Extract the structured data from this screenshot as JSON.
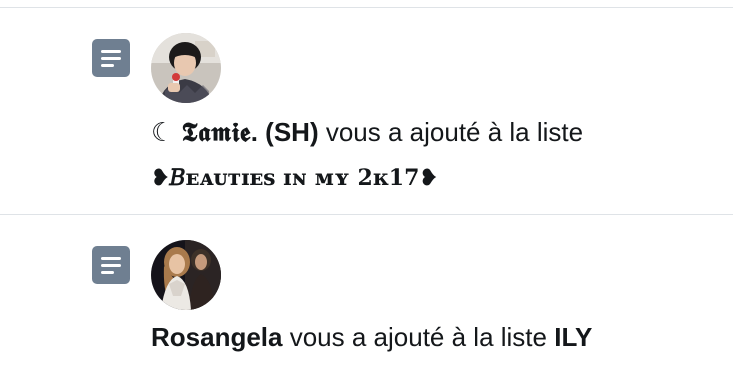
{
  "notifications": [
    {
      "icon": "list-icon",
      "avatar": "user-avatar",
      "moon": "☾",
      "user_name": "𝕿𝖆𝖒𝖎𝖊",
      "user_suffix": ". (SH)",
      "action_text": " vous a ajouté à la liste",
      "list_name": "❥𝐵ᴇᴀᴜᴛɪᴇs ɪɴ ᴍʏ 2ᴋ17❥"
    },
    {
      "icon": "list-icon",
      "avatar": "user-avatar",
      "user_name": "Rosangela",
      "action_text": " vous a ajouté à la liste ",
      "list_name": "ILY"
    }
  ],
  "colors": {
    "icon_bg": "#6f7f91",
    "divider": "#dfe3e7",
    "text": "#14171a"
  }
}
